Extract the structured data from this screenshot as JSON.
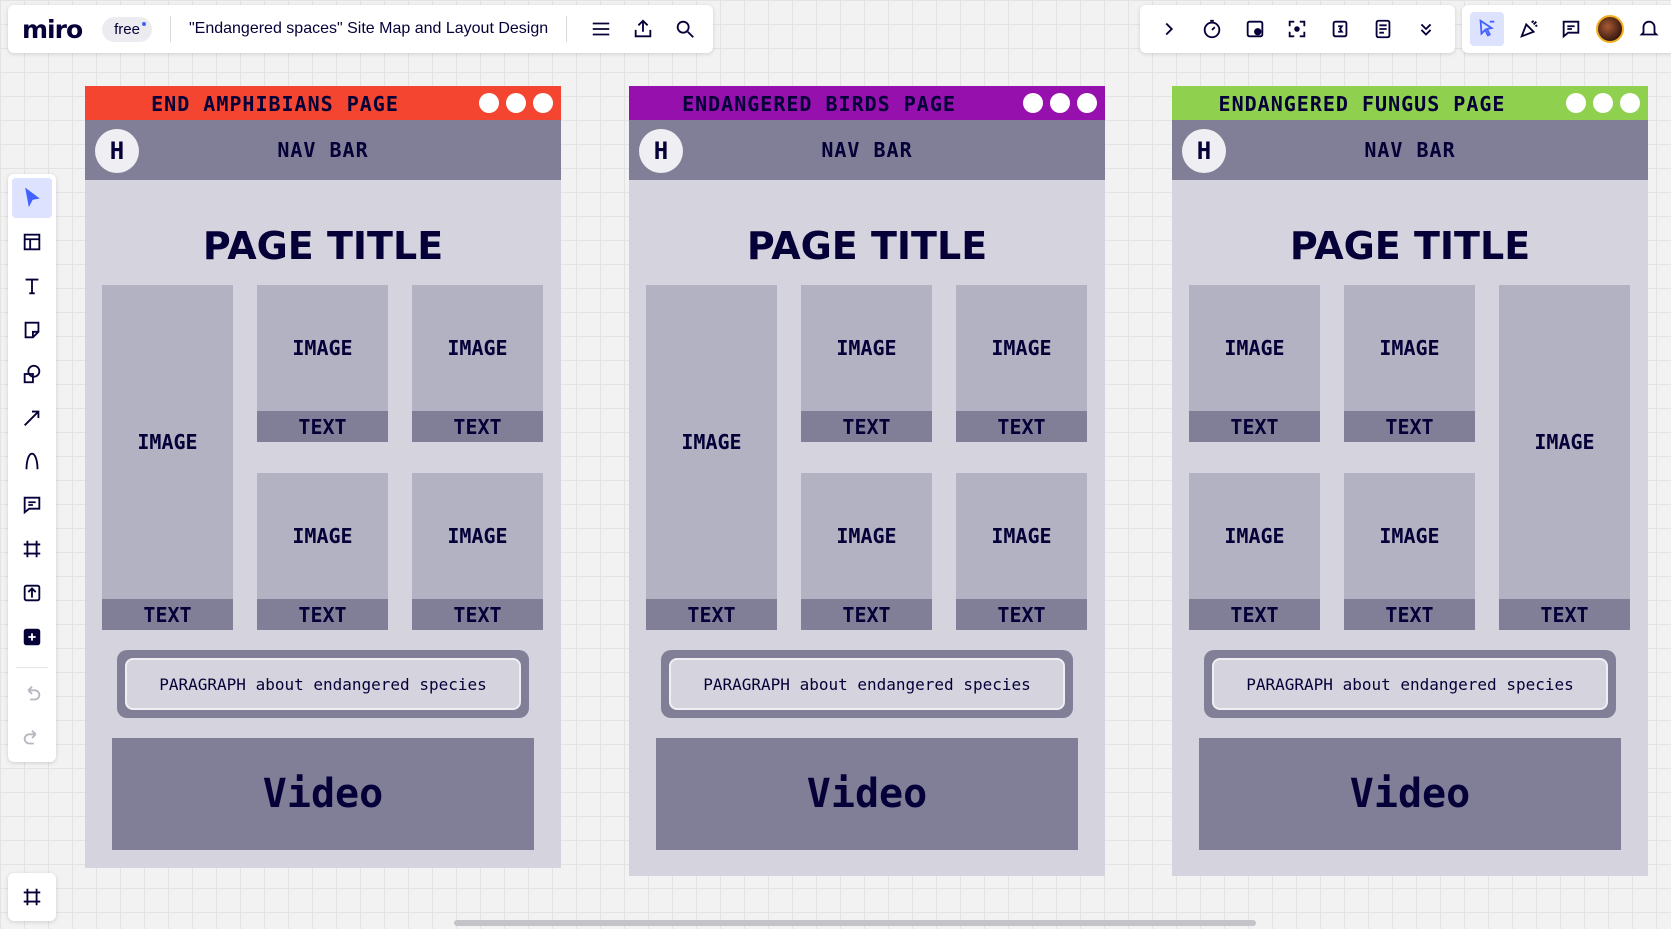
{
  "app": {
    "logo": "miro",
    "plan": "free",
    "board_title": "\"Endangered spaces\" Site Map and Layout Design"
  },
  "topbar_icons": [
    "menu-icon",
    "export-icon",
    "search-icon"
  ],
  "right_toolbar_icons": [
    "chevron-right-icon",
    "timer-icon",
    "voting-icon",
    "focus-icon",
    "calendar-icon",
    "notes-icon",
    "chevron-double-down-icon"
  ],
  "right_toolbar2_icons": [
    "cursor-share-icon",
    "reactions-icon",
    "comments-icon",
    "avatar",
    "bell-icon"
  ],
  "left_tools": [
    "select-tool",
    "templates-tool",
    "text-tool",
    "sticky-note-tool",
    "shapes-tool",
    "pen-arrow-tool",
    "pen-tool",
    "comment-tool",
    "frame-tool",
    "upload-tool",
    "more-apps-tool",
    "undo-tool",
    "redo-tool"
  ],
  "pages": [
    {
      "title": "END AMPHIBIANS PAGE",
      "header_color": "#f44530",
      "nav_initial": "H",
      "nav_label": "NAV BAR",
      "page_title": "PAGE TITLE",
      "tall_image_position": "left",
      "image_label": "IMAGE",
      "text_label": "TEXT",
      "paragraph": "PARAGRAPH about endangered species",
      "video": "Video"
    },
    {
      "title": "ENDANGERED BIRDS PAGE",
      "header_color": "#9510ac",
      "nav_initial": "H",
      "nav_label": "NAV BAR",
      "page_title": "PAGE TITLE",
      "tall_image_position": "left",
      "image_label": "IMAGE",
      "text_label": "TEXT",
      "paragraph": "PARAGRAPH about endangered species",
      "video": "Video"
    },
    {
      "title": "ENDANGERED FUNGUS PAGE",
      "header_color": "#8fd14f",
      "nav_initial": "H",
      "nav_label": "NAV BAR",
      "page_title": "PAGE TITLE",
      "tall_image_position": "right",
      "image_label": "IMAGE",
      "text_label": "TEXT",
      "paragraph": "PARAGRAPH about endangered species",
      "video": "Video"
    }
  ]
}
